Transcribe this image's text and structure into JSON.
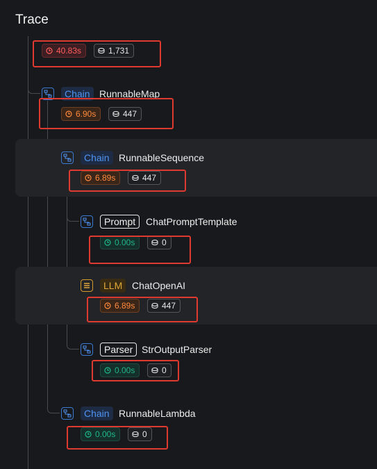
{
  "title": "Trace",
  "root": {
    "latency": "40.83s",
    "tokens": "1,731"
  },
  "nodes": [
    {
      "kind": "chain",
      "tag": "Chain",
      "name": "RunnableMap",
      "latency": "6.90s",
      "tokens": "447"
    },
    {
      "kind": "chain",
      "tag": "Chain",
      "name": "RunnableSequence",
      "latency": "6.89s",
      "tokens": "447"
    },
    {
      "kind": "prompt",
      "tag": "Prompt",
      "name": "ChatPromptTemplate",
      "latency": "0.00s",
      "tokens": "0"
    },
    {
      "kind": "llm",
      "tag": "LLM",
      "name": "ChatOpenAI",
      "latency": "6.89s",
      "tokens": "447"
    },
    {
      "kind": "parser",
      "tag": "Parser",
      "name": "StrOutputParser",
      "latency": "0.00s",
      "tokens": "0"
    },
    {
      "kind": "chain",
      "tag": "Chain",
      "name": "RunnableLambda",
      "latency": "0.00s",
      "tokens": "0"
    }
  ],
  "colors": {
    "latency_high": "#ff5c5c",
    "latency_mid": "#ff8a3d",
    "latency_low": "#1fb68c",
    "chain": "#4f93f0",
    "llm": "#e0a73a",
    "annotation": "#e0392f"
  },
  "icons": {
    "chain": "flow-icon",
    "llm": "stack-icon",
    "latency": "clock-icon",
    "tokens": "coins-icon"
  }
}
